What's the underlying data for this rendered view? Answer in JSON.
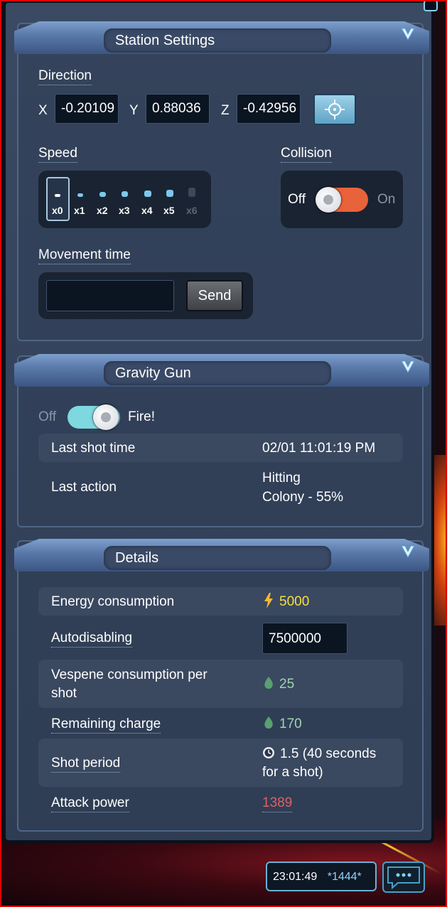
{
  "station_settings": {
    "title": "Station Settings",
    "direction_label": "Direction",
    "x_label": "X",
    "x_value": "-0.20109",
    "y_label": "Y",
    "y_value": "0.88036",
    "z_label": "Z",
    "z_value": "-0.42956",
    "speed_label": "Speed",
    "speed_options": [
      "x0",
      "x1",
      "x2",
      "x3",
      "x4",
      "x5",
      "x6"
    ],
    "speed_selected": "x0",
    "collision_label": "Collision",
    "collision_off": "Off",
    "collision_on": "On",
    "collision_state": "on",
    "movement_time_label": "Movement time",
    "movement_time_value": "",
    "send_label": "Send"
  },
  "gravity_gun": {
    "title": "Gravity Gun",
    "toggle_off": "Off",
    "toggle_on": "Fire!",
    "toggle_state": "on",
    "last_shot_label": "Last shot time",
    "last_shot_value": "02/01 11:01:19 PM",
    "last_action_label": "Last action",
    "last_action_line1": "Hitting",
    "last_action_line2": "Colony - 55%"
  },
  "details": {
    "title": "Details",
    "energy_label": "Energy consumption",
    "energy_value": "5000",
    "autodisabling_label": "Autodisabling",
    "autodisabling_value": "7500000",
    "vespene_label_line1": "Vespene consumption per",
    "vespene_label_line2": "shot",
    "vespene_value": "25",
    "remaining_label": "Remaining charge",
    "remaining_value": "170",
    "shot_period_label": "Shot period",
    "shot_period_line1": "1.5 (40 seconds",
    "shot_period_line2": "for a shot)",
    "attack_label": "Attack power",
    "attack_value": "1389"
  },
  "status_bar": {
    "time": "23:01:49",
    "tag": "*1444*"
  },
  "colors": {
    "accent_cyan": "#7fd8e0",
    "energy_yellow": "#f5e040",
    "vespene_green": "#9fd5b0",
    "attack_red": "#e06060",
    "toggle_orange": "#e8623a"
  }
}
